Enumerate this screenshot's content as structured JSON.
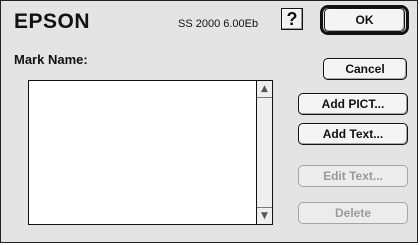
{
  "header": {
    "brand": "EPSON",
    "version": "SS 2000 6.00Eb",
    "help_label": "?"
  },
  "form": {
    "mark_name_label": "Mark Name:"
  },
  "buttons": {
    "ok": "OK",
    "cancel": "Cancel",
    "add_pict": "Add PICT...",
    "add_text": "Add Text...",
    "edit_text": "Edit Text...",
    "delete": "Delete"
  },
  "list": {
    "items": []
  },
  "icons": {
    "help": "question-mark-icon",
    "scroll_up": "scroll-up-arrow-icon",
    "scroll_down": "scroll-down-arrow-icon"
  }
}
